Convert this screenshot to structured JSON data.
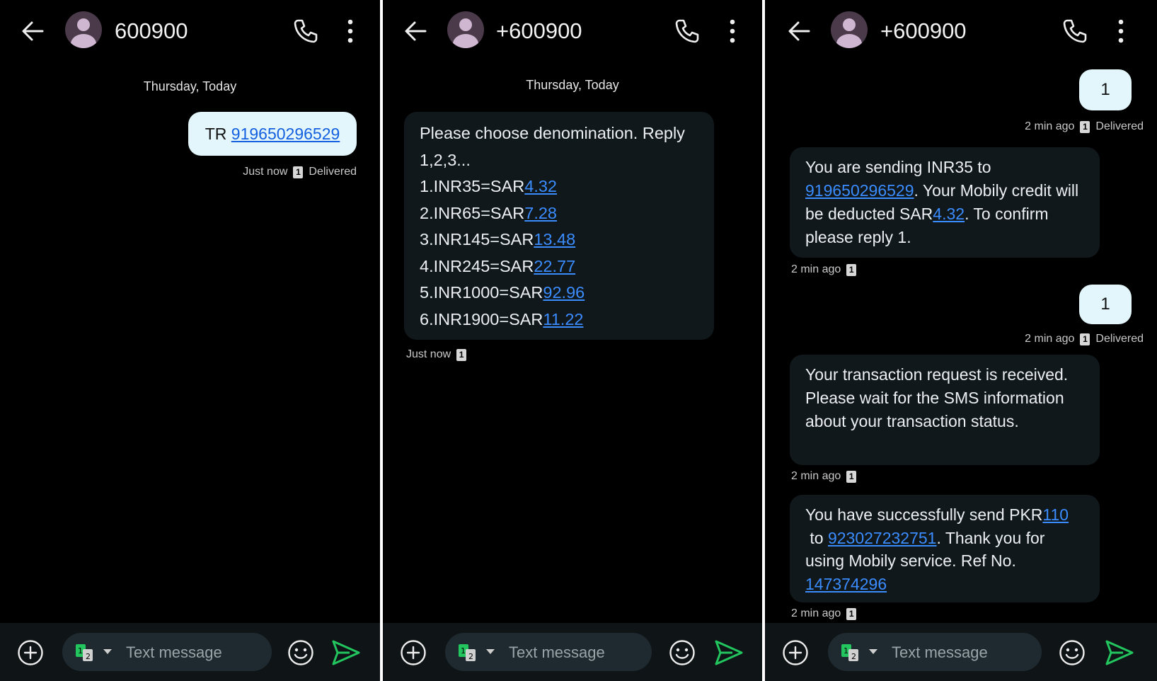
{
  "panels": [
    {
      "title": "600900",
      "date_label": "Thursday, Today",
      "outgoing": {
        "prefix": "TR ",
        "number": "919650296529"
      },
      "outgoing_meta": {
        "time": "Just now",
        "sim": "1",
        "status": "Delivered"
      },
      "input_placeholder": "Text message",
      "sim_slot": "1 2"
    },
    {
      "title": "+600900",
      "date_label": "Thursday, Today",
      "incoming": {
        "intro": "Please choose denomination. Reply 1,2,3...",
        "options": [
          {
            "label": "1.INR35=SAR",
            "value": "4.32"
          },
          {
            "label": "2.INR65=SAR",
            "value": "7.28"
          },
          {
            "label": "3.INR145=SAR",
            "value": "13.48"
          },
          {
            "label": "4.INR245=SAR",
            "value": "22.77"
          },
          {
            "label": "5.INR1000=SAR",
            "value": "92.96"
          },
          {
            "label": "6.INR1900=SAR",
            "value": "11.22"
          }
        ]
      },
      "incoming_meta": {
        "time": "Just now",
        "sim": "1"
      },
      "input_placeholder": "Text message",
      "sim_slot": "1 2"
    },
    {
      "title": "+600900",
      "out1": "1",
      "out1_meta": {
        "time": "2 min ago",
        "sim": "1",
        "status": "Delivered"
      },
      "in1": {
        "t1": "You are sending INR35 to ",
        "num": "919650296529",
        "t2": ". Your Mobily credit will be deducted SAR",
        "amt": "4.32",
        "t3": ". To confirm please reply 1."
      },
      "in1_meta": {
        "time": "2 min ago",
        "sim": "1"
      },
      "out2": "1",
      "out2_meta": {
        "time": "2 min ago",
        "sim": "1",
        "status": "Delivered"
      },
      "in2": "Your transaction request is received. Please wait for the SMS information about your transaction status.",
      "in2_meta": {
        "time": "2 min ago",
        "sim": "1"
      },
      "in3": {
        "t1": "You have successfully send PKR",
        "amt": "110",
        "t2": " to ",
        "num": "923027232751",
        "t3": ". Thank you for using Mobily service. Ref No. ",
        "ref": "147374296"
      },
      "in3_meta": {
        "time": "2 min ago",
        "sim": "1"
      },
      "input_placeholder": "Text message",
      "sim_slot": "1 2"
    }
  ],
  "icons": {
    "back": "arrow-left-icon",
    "phone": "phone-icon",
    "more": "more-vertical-icon",
    "add": "add-circle-icon",
    "emoji": "emoji-icon",
    "send": "send-icon",
    "sim": "dual-sim-icon"
  },
  "colors": {
    "background": "#000000",
    "outgoing_bubble": "#e2f6fb",
    "incoming_bubble": "#11181c",
    "link": "#3a8cff",
    "send_accent": "#22c55e"
  }
}
